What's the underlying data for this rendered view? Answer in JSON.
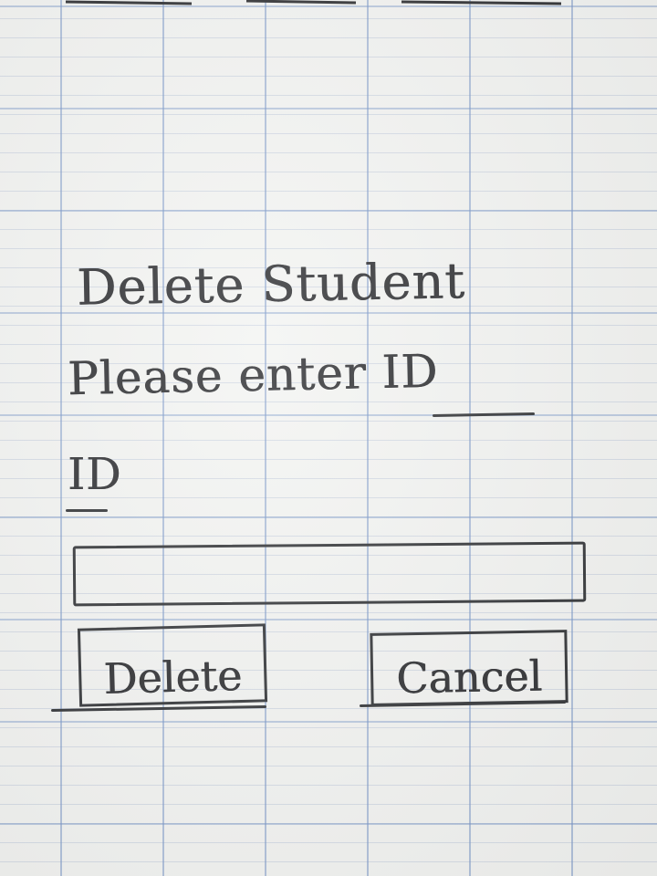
{
  "dialog": {
    "title": "Delete Student",
    "instruction": "Please enter ID",
    "id_label": "ID",
    "id_input_value": "",
    "buttons": {
      "delete_label": "Delete",
      "cancel_label": "Cancel"
    }
  },
  "colors": {
    "paper": "#f3f4f2",
    "grid_major": "#7896c8",
    "ink": "#2f3033"
  }
}
